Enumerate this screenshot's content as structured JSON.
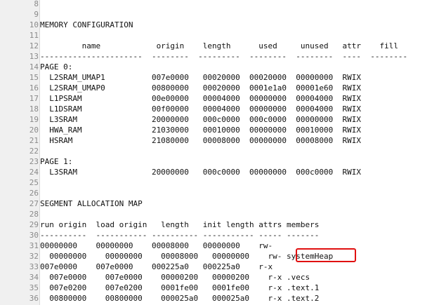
{
  "editor": {
    "lines": [
      {
        "num": "8",
        "text": ""
      },
      {
        "num": "9",
        "text": ""
      },
      {
        "num": "10",
        "text": "MEMORY CONFIGURATION"
      },
      {
        "num": "11",
        "text": ""
      },
      {
        "num": "12",
        "text": "         name            origin    length      used     unused   attr    fill"
      },
      {
        "num": "13",
        "text": "----------------------  --------  ---------  --------  --------  ----  --------"
      },
      {
        "num": "14",
        "text": "PAGE 0:"
      },
      {
        "num": "15",
        "text": "  L2SRAM_UMAP1          007e0000   00020000  00020000  00000000  RWIX"
      },
      {
        "num": "16",
        "text": "  L2SRAM_UMAP0          00800000   00020000  0001e1a0  00001e60  RWIX"
      },
      {
        "num": "17",
        "text": "  L1PSRAM               00e00000   00004000  00000000  00004000  RWIX"
      },
      {
        "num": "18",
        "text": "  L1DSRAM               00f00000   00004000  00000000  00004000  RWIX"
      },
      {
        "num": "19",
        "text": "  L3SRAM                20000000   000c0000  000c0000  00000000  RWIX"
      },
      {
        "num": "20",
        "text": "  HWA_RAM               21030000   00010000  00000000  00010000  RWIX"
      },
      {
        "num": "21",
        "text": "  HSRAM                 21080000   00008000  00000000  00008000  RWIX"
      },
      {
        "num": "22",
        "text": ""
      },
      {
        "num": "23",
        "text": "PAGE 1:"
      },
      {
        "num": "24",
        "text": "  L3SRAM                20000000   000c0000  00000000  000c0000  RWIX"
      },
      {
        "num": "25",
        "text": ""
      },
      {
        "num": "26",
        "text": ""
      },
      {
        "num": "27",
        "text": "SEGMENT ALLOCATION MAP"
      },
      {
        "num": "28",
        "text": ""
      },
      {
        "num": "29",
        "text": "run origin  load origin   length   init length attrs members"
      },
      {
        "num": "30",
        "text": "----------  ----------- ---------- ----------- ----- -------"
      },
      {
        "num": "31",
        "text": "00000000    00000000    00008000   00000000    rw-"
      },
      {
        "num": "32",
        "text": "  00000000    00000000    00008000   00000000    rw- systemHeap"
      },
      {
        "num": "33",
        "text": "007e0000    007e0000    000225a0   000225a0    r-x"
      },
      {
        "num": "34",
        "text": "  007e0000    007e0000    00000200   00000200    r-x .vecs"
      },
      {
        "num": "35",
        "text": "  007e0200    007e0200    0001fe00   0001fe00    r-x .text.1"
      },
      {
        "num": "36",
        "text": "  00800000    00800000    000025a0   000025a0    r-x .text.2"
      }
    ]
  },
  "highlight": {
    "label": "systemHeap",
    "color": "#e01010"
  },
  "colors": {
    "gutter_bg": "#f0f0f0",
    "line_number": "#8a8a8a",
    "text": "#111111",
    "highlight_border": "#e01010"
  }
}
